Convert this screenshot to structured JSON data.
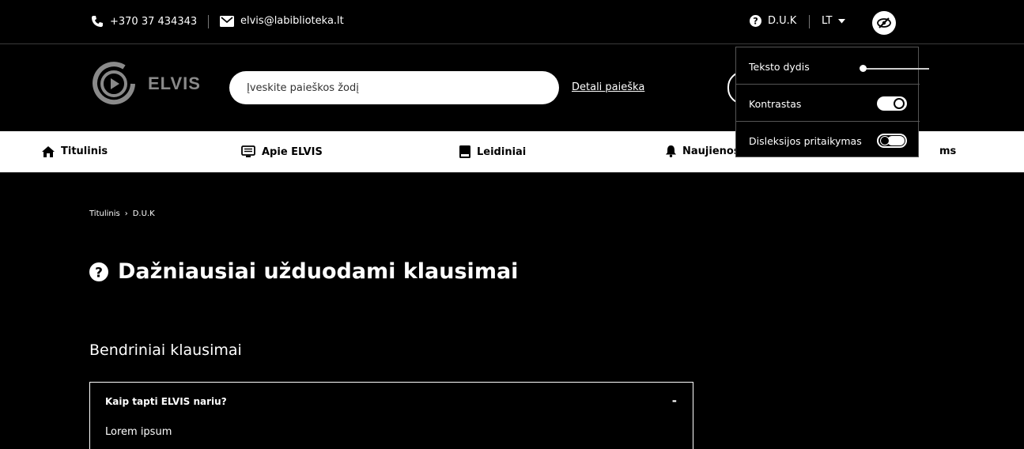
{
  "topbar": {
    "phone": "+370 37 434343",
    "email": "elvis@labiblioteka.lt",
    "faq_link": "D.U.K",
    "language": "LT"
  },
  "header": {
    "logo_text": "ELVIS",
    "search_placeholder": "Įveskite paieškos žodį",
    "advanced_search": "Detali paieška"
  },
  "nav": {
    "items": [
      {
        "label": "Titulinis",
        "icon": "home-icon"
      },
      {
        "label": "Apie ELVIS",
        "icon": "monitor-icon"
      },
      {
        "label": "Leidiniai",
        "icon": "book-icon"
      },
      {
        "label": "Naujienos",
        "icon": "bell-icon"
      },
      {
        "label": "ms"
      }
    ]
  },
  "main": {
    "breadcrumb": [
      "Titulinis",
      "D.U.K"
    ],
    "title": "Dažniausiai užduodami klausimai",
    "section_title": "Bendriniai klausimai",
    "faq": [
      {
        "question": "Kaip tapti ELVIS nariu?",
        "toggle": "-",
        "answer": "Lorem ipsum"
      }
    ]
  },
  "accessibility": {
    "text_size_label": "Teksto dydis",
    "text_size_level": 0.0,
    "contrast_label": "Kontrastas",
    "contrast_on": true,
    "dyslexia_label": "Disleksijos pritaikymas",
    "dyslexia_on": false
  }
}
